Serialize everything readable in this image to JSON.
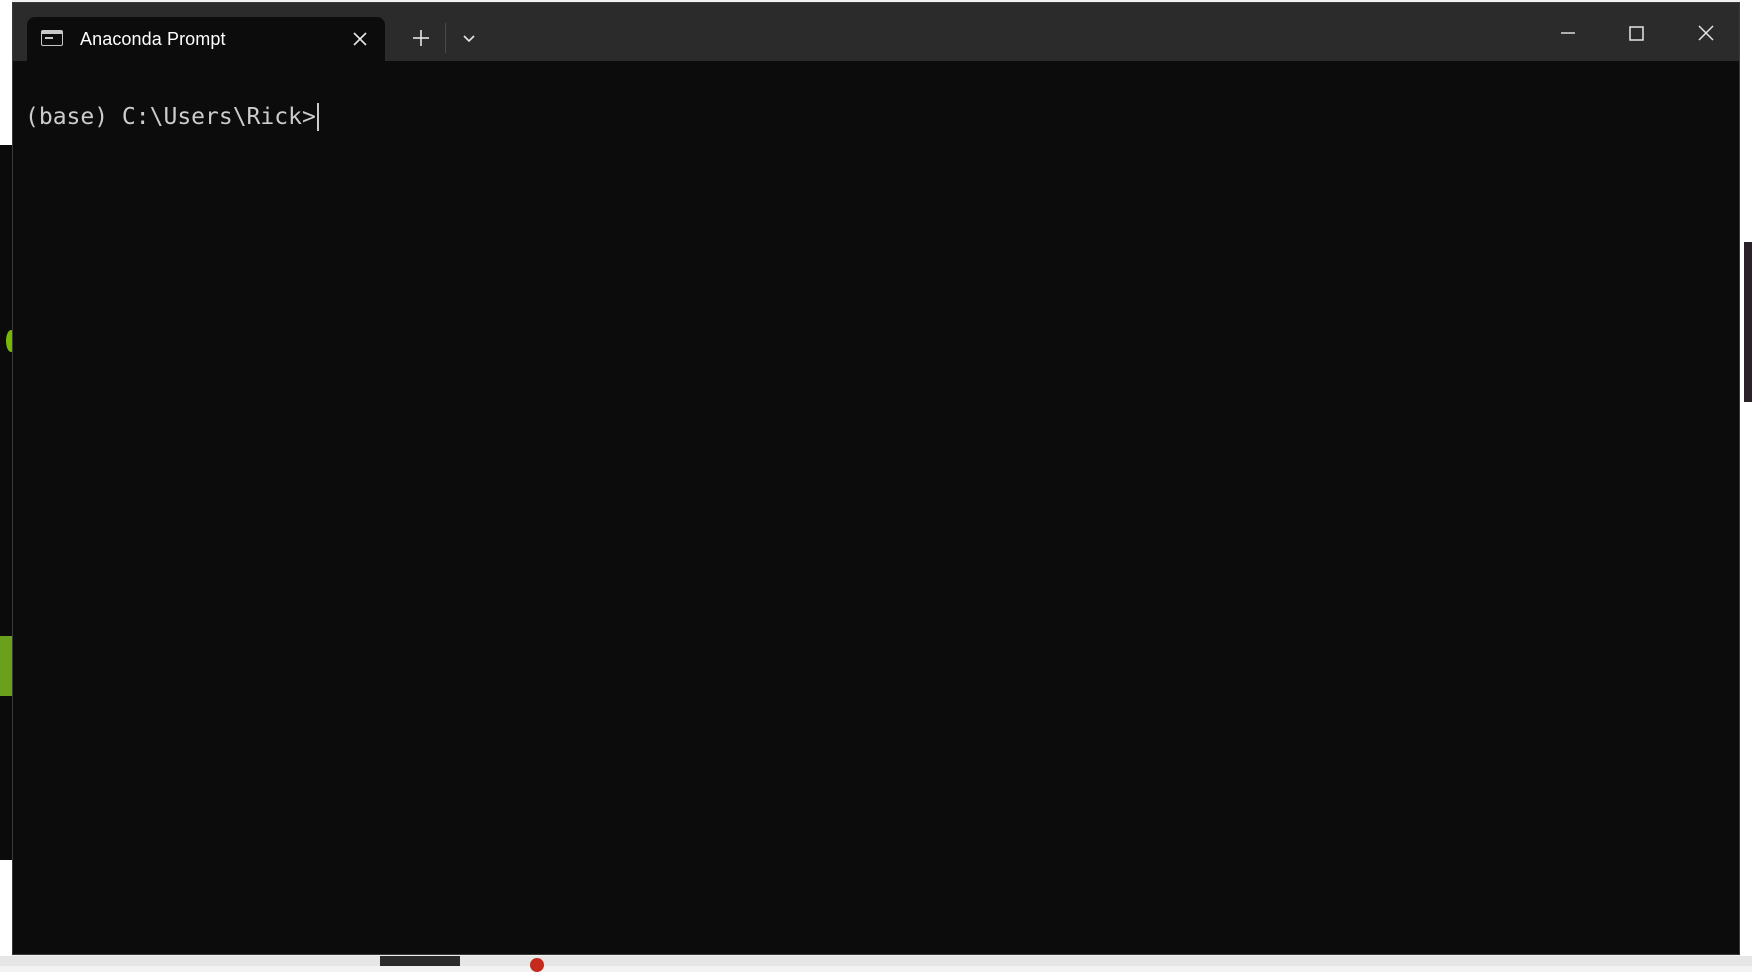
{
  "window": {
    "tab_title": "Anaconda Prompt",
    "tab_icon": "terminal-icon",
    "new_tab_icon": "plus-icon",
    "dropdown_icon": "chevron-down-icon",
    "caption": {
      "minimize_icon": "minimize-icon",
      "maximize_icon": "maximize-icon",
      "close_icon": "close-icon"
    }
  },
  "terminal": {
    "prompt": "(base) C:\\Users\\Rick>"
  },
  "colors": {
    "titlebar": "#2b2b2b",
    "terminal_background": "#0c0c0c",
    "terminal_text": "#cccccc"
  }
}
